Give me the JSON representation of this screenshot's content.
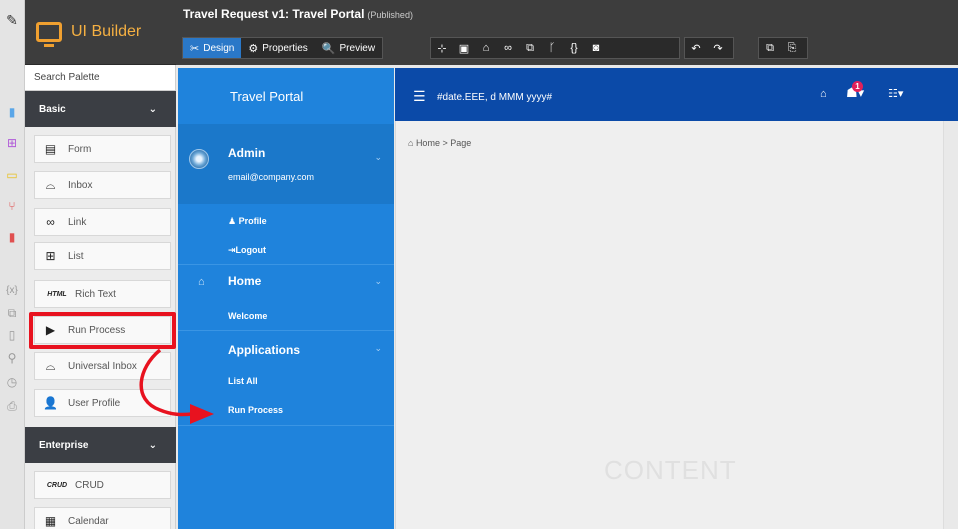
{
  "app": {
    "name": "UI Builder"
  },
  "header": {
    "title": "Travel Request v1: Travel Portal",
    "status": "(Published)",
    "modes": [
      {
        "label": "Design",
        "icon": "✂"
      },
      {
        "label": "Properties",
        "icon": "⚙"
      },
      {
        "label": "Preview",
        "icon": "🔍"
      }
    ]
  },
  "palette": {
    "search_placeholder": "Search Palette",
    "categories": [
      {
        "label": "Basic",
        "chevron": "⌄"
      },
      {
        "label": "Enterprise",
        "chevron": "⌄"
      }
    ],
    "items": [
      {
        "label": "Form",
        "icon": "▤"
      },
      {
        "label": "Inbox",
        "icon": "⌓"
      },
      {
        "label": "Link",
        "icon": "∞"
      },
      {
        "label": "List",
        "icon": "⊞"
      },
      {
        "label": "Rich Text",
        "icon": "HTML"
      },
      {
        "label": "Run Process",
        "icon": "▶"
      },
      {
        "label": "Universal Inbox",
        "icon": "⌓"
      },
      {
        "label": "User Profile",
        "icon": "👤"
      },
      {
        "label": "CRUD",
        "icon": "CRUD"
      },
      {
        "label": "Calendar",
        "icon": "▦"
      }
    ]
  },
  "portal": {
    "title": "Travel Portal",
    "user": {
      "name": "Admin",
      "email": "email@company.com"
    },
    "user_menu": [
      "Profile",
      "Logout"
    ],
    "nav": [
      {
        "label": "Home",
        "items": [
          "Welcome"
        ]
      },
      {
        "label": "Applications",
        "items": [
          "List All",
          "Run Process"
        ]
      }
    ],
    "date_format": "#date.EEE, d MMM yyyy#",
    "notification_count": "1",
    "breadcrumb": "Home > Page",
    "content_placeholder": "CONTENT"
  },
  "colors": {
    "sidebar_bg": "#1f83dc",
    "topnav_bg": "#0b4aa8",
    "dark_chrome": "#3d3d3d",
    "highlight": "#e8121f",
    "logo_accent": "#f0a030"
  }
}
